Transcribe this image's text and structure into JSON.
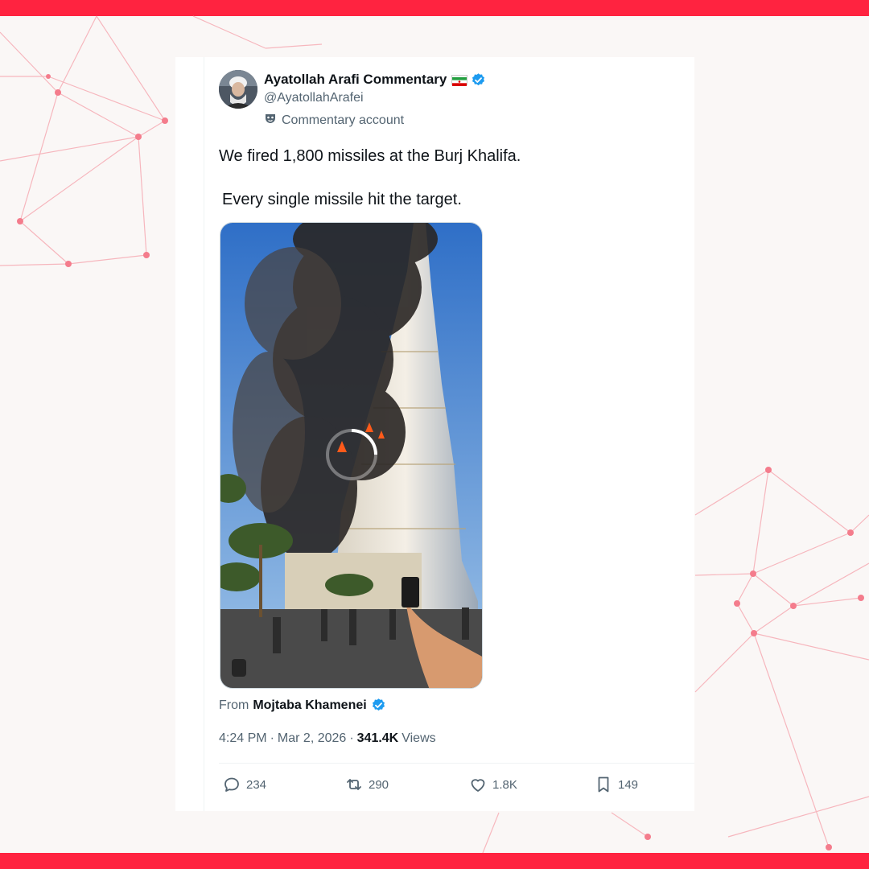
{
  "colors": {
    "accent": "#ff2340",
    "verified": "#1d9bf0",
    "muted": "#536471"
  },
  "tweet": {
    "author_name": "Ayatollah Arafi Commentary",
    "handle": "@AyatollahArafei",
    "account_label": "Commentary account",
    "text_line_1": "We fired 1,800 missiles at the Burj Khalifa.",
    "text_line_2": "Every single missile hit the target.",
    "from_prefix": "From",
    "from_name": "Mojtaba Khamenei",
    "time": "4:24 PM",
    "date": "Mar 2, 2026",
    "views_count": "341.4K",
    "views_label": "Views",
    "sep": "·"
  },
  "actions": {
    "replies": "234",
    "reposts": "290",
    "likes": "1.8K",
    "bookmarks": "149"
  },
  "icons": {
    "verified": "verified-badge-icon",
    "flag": "iran-flag-icon",
    "commentary": "mask-icon",
    "reply": "reply-bubble-icon",
    "repost": "repost-arrows-icon",
    "like": "heart-icon",
    "bookmark": "bookmark-icon",
    "loading": "loading-spinner-icon"
  }
}
